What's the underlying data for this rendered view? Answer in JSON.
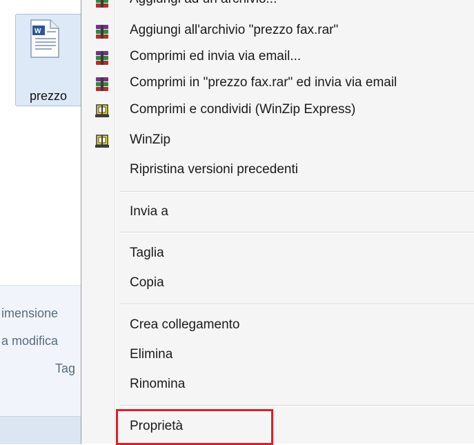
{
  "explorer": {
    "file_label": "prezzo",
    "details": [
      "imensione",
      "a modifica",
      "Tag"
    ]
  },
  "menu": {
    "items": [
      {
        "label": "Aggiungi ad un archivio...",
        "icon": "winrar-icon"
      },
      {
        "label": "Aggiungi all'archivio \"prezzo fax.rar\"",
        "icon": "winrar-icon"
      },
      {
        "label": "Comprimi ed invia via email...",
        "icon": "winrar-icon"
      },
      {
        "label": "Comprimi in \"prezzo fax.rar\" ed invia via email",
        "icon": "winrar-icon"
      },
      {
        "label": "Comprimi e condividi (WinZip Express)",
        "icon": "winzip-icon"
      },
      {
        "label": "WinZip",
        "icon": "winzip-icon"
      },
      {
        "label": "Ripristina versioni precedenti",
        "icon": ""
      },
      {
        "label": "Invia a",
        "icon": ""
      },
      {
        "label": "Taglia",
        "icon": ""
      },
      {
        "label": "Copia",
        "icon": ""
      },
      {
        "label": "Crea collegamento",
        "icon": ""
      },
      {
        "label": "Elimina",
        "icon": ""
      },
      {
        "label": "Rinomina",
        "icon": ""
      },
      {
        "label": "Proprietà",
        "icon": ""
      }
    ]
  },
  "highlight_color": "#e01b24"
}
